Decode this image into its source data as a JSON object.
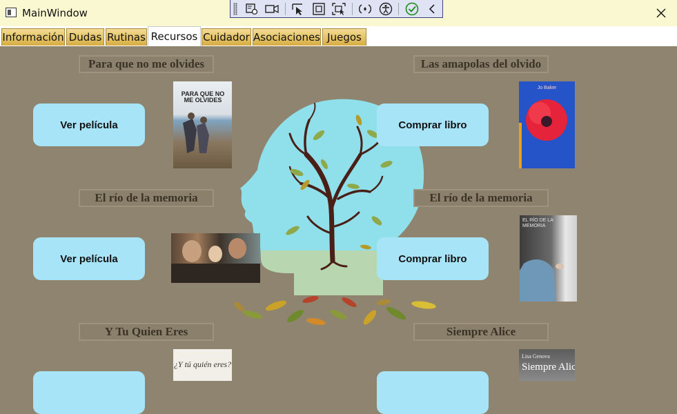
{
  "window": {
    "title": "MainWindow"
  },
  "debug_toolbar": {
    "icons": [
      "select-element-icon",
      "record-icon",
      "select-pointer-icon",
      "display-layout-icon",
      "track-focus-icon",
      "hot-reload-icon",
      "accessibility-icon",
      "checkmark-icon",
      "collapse-icon"
    ]
  },
  "tabs": [
    {
      "label": "Información"
    },
    {
      "label": "Dudas"
    },
    {
      "label": "Rutinas"
    },
    {
      "label": "Recursos"
    },
    {
      "label": "Cuidador"
    },
    {
      "label": "Asociaciones"
    },
    {
      "label": "Juegos"
    }
  ],
  "active_tab": "Recursos",
  "resources": {
    "left": [
      {
        "title": "Para que no me olvides",
        "button": "Ver película"
      },
      {
        "title": "El río de la memoria",
        "button": "Ver película"
      },
      {
        "title": "Y Tu Quien Eres"
      }
    ],
    "right": [
      {
        "title": "Las amapolas del olvido",
        "button": "Comprar libro"
      },
      {
        "title": "El río de la memoria",
        "button": "Comprar libro"
      },
      {
        "title": "Siempre Alice"
      }
    ]
  },
  "covers": {
    "poster1": {
      "title": "PARA QUE NO ME OLVIDES"
    },
    "book1": {
      "author": "Jo Baker",
      "title": "Las amapolas del olvido"
    },
    "book2": {
      "title": "EL RÍO DE LA MEMORIA"
    },
    "poster3": {
      "title": "¿Y tú quién eres?"
    },
    "book3": {
      "author": "Lisa Genova",
      "title": "Siempre Alice"
    }
  },
  "colors": {
    "background": "#8e8470",
    "title_bar": "#f9f8d0",
    "tab_gold": "#d7ad42",
    "button": "#a8e4f7",
    "head": "#8fe0ea",
    "head_base": "#b8d6b0",
    "tree": "#4a1f17"
  }
}
